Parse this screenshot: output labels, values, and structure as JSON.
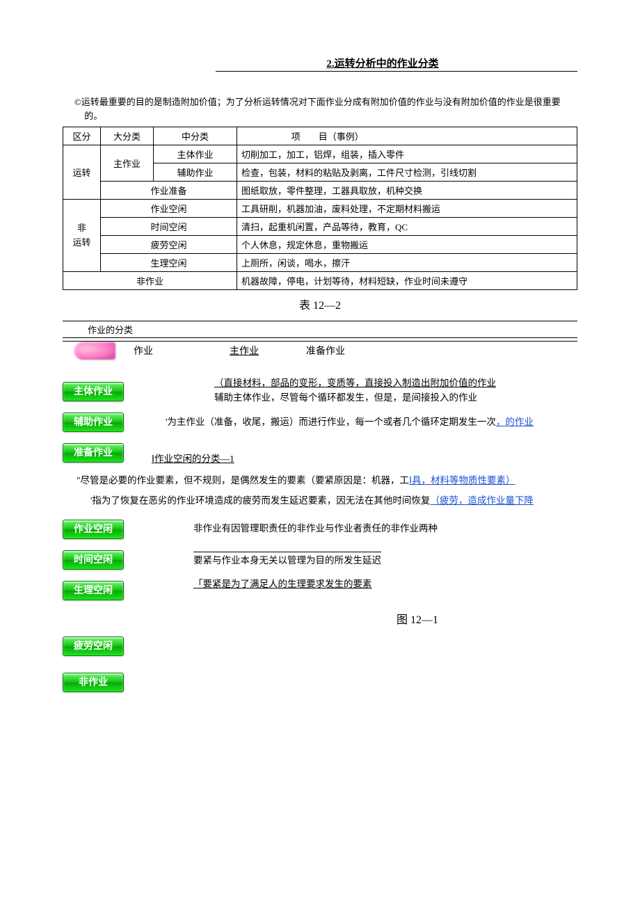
{
  "title": "2.运转分析中的作业分类",
  "intro": "©运转最重要的目的是制造附加价值；为了分析运转情况对下面作业分成有附加价值的作业与没有附加价值的作业是很重要的。",
  "table": {
    "headers": {
      "c1": "区分",
      "c2": "大分类",
      "c3": "中分类",
      "c4": "项　　目（事例）"
    },
    "rows": [
      {
        "c1": "运转",
        "c2": "主作业",
        "c3a": "主体作业",
        "c4a": "切削加工，加工，铝焊，组装，插入零件",
        "c3b": "辅助作业",
        "c4b": "检查，包装，材料的粘贴及剥离，工件尺寸检测，引线切割",
        "c3c": "作业准备",
        "c4c": "图纸取放，零件整理，工器具取放，机种交换"
      },
      {
        "c1": "非\n运转",
        "r1c3": "作业空闲",
        "r1c4": "工具研削，机器加油，废料处理，不定期材料搬运",
        "r2c3": "时间空闲",
        "r2c4": "清扫，起重机闲置，产品等待，教育，QC",
        "r3c3": "疲劳空闲",
        "r3c4": "个人休息，规定休息，重物搬运",
        "r4c3": "生理空闲",
        "r4c4": "上厕所，闲谈，喝水，擦汗"
      },
      {
        "colspan_label": "非作业",
        "c4": "机器故障，停电，计划等待，材料短缺，作业时间未遵守"
      }
    ]
  },
  "table_caption": "表 12—2",
  "class_section_title": "作业的分类",
  "stub_row": {
    "a": "作业",
    "b": "主作业",
    "c": "准备作业"
  },
  "badges": {
    "main_body": "主体作业",
    "assist": "辅助作业",
    "prepare": "准备作业",
    "idle_work": "作业空闲",
    "idle_time": "时间空闲",
    "idle_phys": "生理空闲",
    "idle_fat": "疲劳空闲",
    "nonwork": "非作业"
  },
  "defs": {
    "main_body_line1": "（直接材料，部品的变形，变质等，直接投入制造出附加价值的作业",
    "main_body_line2": "辅助主体作业，尽管每个循环都发生，但是，是间接投入的作业",
    "assist_line": "'为主作业（准备，收尾，搬运）而进行作业，每一个或者几个循环定期发生一次",
    "assist_link": "，的作业",
    "prepare_heading_pre": "Ⅰ作业空闲的分类—1",
    "idle_work_para_pre": "\"尽管是必要的作业要素，但不规则，是偶然发生的要素（要紧原因是：机器，工",
    "idle_work_para_link": "Ⅰ具，材料等物质性要素）",
    "idle_time_para_pre": "'指为了恢复在恶劣的作业环境造成的疲劳而发生延迟要素，因无法在其他时间恢复",
    "idle_time_para_link": "（疲劳，造成作业量下降",
    "nonwork_desc": "非作业有因管理职责任的非作业与作业者责任的非作业两种",
    "time_desc": "要紧与作业本身无关以管理为目的所发生延迟",
    "phys_desc": "「要紧是为了满足人的生理要求发生的要素"
  },
  "figure_caption": "图 12—1"
}
